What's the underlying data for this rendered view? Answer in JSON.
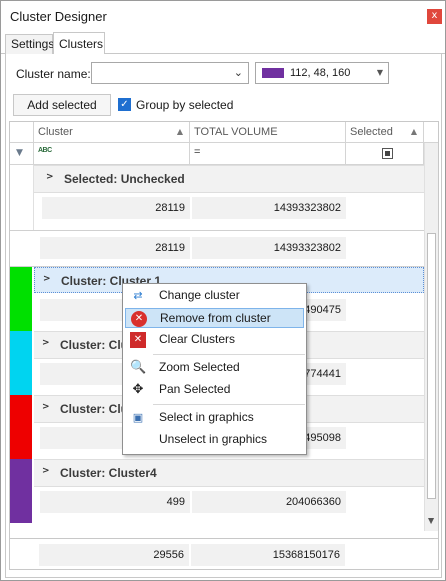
{
  "window": {
    "title": "Cluster Designer",
    "close_glyph": "x"
  },
  "tabs": [
    {
      "label": "Settings"
    },
    {
      "label": "Clusters"
    }
  ],
  "form": {
    "cluster_name_label": "Cluster name:",
    "cluster_name_value": "",
    "color_value": "112, 48, 160",
    "color_hex": "#7030a0",
    "add_selected_label": "Add selected",
    "group_by_selected_label": "Group by selected",
    "group_by_selected_checked": true
  },
  "grid": {
    "columns": [
      {
        "label": "Cluster"
      },
      {
        "label": "TOTAL VOLUME"
      },
      {
        "label": "Selected"
      }
    ],
    "filter_eq": "=",
    "groups": [
      {
        "title": "Selected: Unchecked",
        "rows": [
          {
            "count": "28119",
            "volume": "14393323802"
          }
        ]
      },
      {
        "summary": {
          "count": "28119",
          "volume": "14393323802"
        }
      },
      {
        "title": "Cluster: Cluster 1",
        "color": "#00e000",
        "rows": [
          {
            "count": "",
            "volume": "490475"
          }
        ]
      },
      {
        "title": "Cluster: Clu",
        "color": "#00d4f0",
        "rows": [
          {
            "count": "",
            "volume": "774441"
          }
        ]
      },
      {
        "title": "Cluster: Clu",
        "color": "#ee0000",
        "rows": [
          {
            "count": "",
            "volume": "495098"
          }
        ]
      },
      {
        "title": "Cluster: Cluster4",
        "color": "#7030a0",
        "rows": [
          {
            "count": "499",
            "volume": "204066360"
          }
        ]
      }
    ],
    "footer": {
      "count": "29556",
      "volume": "15368150176"
    }
  },
  "context_menu": {
    "items": [
      {
        "label": "Change cluster",
        "icon": "change-cluster-icon"
      },
      {
        "label": "Remove from cluster",
        "icon": "remove-icon",
        "highlighted": true
      },
      {
        "label": "Clear Clusters",
        "icon": "clear-icon"
      },
      {
        "label": "Zoom Selected",
        "icon": "zoom-icon"
      },
      {
        "label": "Pan Selected",
        "icon": "pan-icon"
      },
      {
        "label": "Select in graphics",
        "icon": "select-graphics-icon"
      },
      {
        "label": "Unselect in graphics",
        "icon": ""
      }
    ]
  }
}
